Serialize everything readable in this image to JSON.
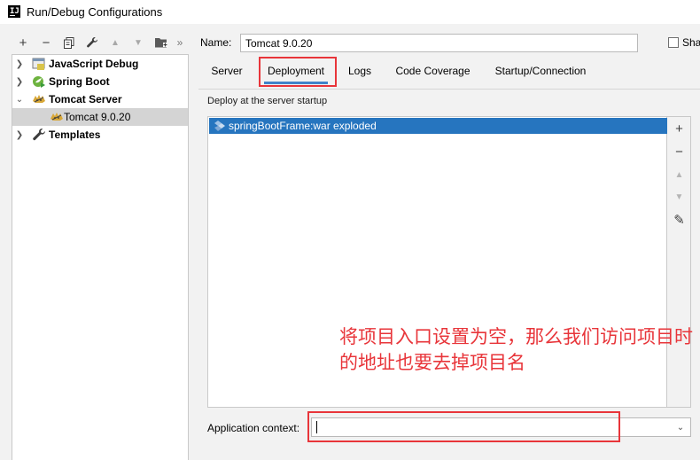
{
  "window": {
    "title": "Run/Debug Configurations",
    "app_icon_text": "IJ"
  },
  "toolbar": {
    "buttons": [
      {
        "name": "add",
        "glyph": "+"
      },
      {
        "name": "remove",
        "glyph": "−"
      },
      {
        "name": "copy",
        "glyph": "⧉"
      },
      {
        "name": "edit-defaults",
        "glyph": "🔧"
      },
      {
        "name": "move-up",
        "glyph": "▲"
      },
      {
        "name": "move-down",
        "glyph": "▼"
      },
      {
        "name": "folder",
        "glyph": "▪"
      },
      {
        "name": "more",
        "glyph": "»"
      }
    ]
  },
  "tree": {
    "items": [
      {
        "label": "JavaScript Debug",
        "icon": "javascript-debug-icon",
        "expanded": false,
        "level": 0
      },
      {
        "label": "Spring Boot",
        "icon": "spring-boot-icon",
        "expanded": false,
        "level": 0
      },
      {
        "label": "Tomcat Server",
        "icon": "tomcat-icon",
        "expanded": true,
        "level": 0
      },
      {
        "label": "Tomcat 9.0.20",
        "icon": "tomcat-icon",
        "level": 1,
        "selected": true
      },
      {
        "label": "Templates",
        "icon": "wrench-icon",
        "expanded": false,
        "level": 0
      }
    ]
  },
  "form": {
    "name_label": "Name:",
    "name_value": "Tomcat 9.0.20",
    "share_label": "Sha",
    "tabs": [
      "Server",
      "Deployment",
      "Logs",
      "Code Coverage",
      "Startup/Connection"
    ],
    "active_tab": "Deployment",
    "deploy_group_title": "Deploy at the server startup",
    "deploy_items": [
      "springBootFrame:war exploded"
    ],
    "app_context_label": "Application context:",
    "app_context_value": ""
  },
  "side_tools": [
    {
      "name": "add",
      "glyph": "+"
    },
    {
      "name": "remove",
      "glyph": "−"
    },
    {
      "name": "move-up",
      "glyph": "▲"
    },
    {
      "name": "move-down",
      "glyph": "▼"
    },
    {
      "name": "edit",
      "glyph": "✎"
    }
  ],
  "annotation": {
    "text": "将项目入口设置为空，那么我们访问项目时的地址也要去掉项目名",
    "color": "#e8353a"
  },
  "colors": {
    "selection": "#2675bf",
    "tab_underline": "#4083c9",
    "annotation": "#e8353a"
  }
}
